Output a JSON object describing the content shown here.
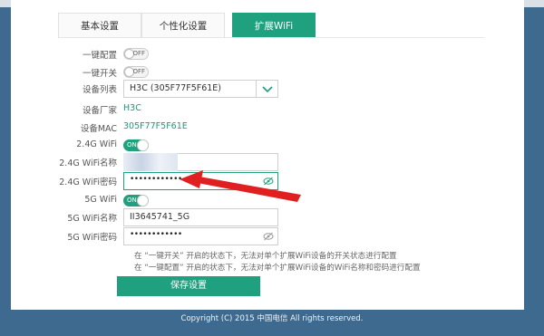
{
  "tabs": [
    {
      "label": "基本设置"
    },
    {
      "label": "个性化设置"
    },
    {
      "label": "扩展WiFi"
    }
  ],
  "form": {
    "one_key_config": {
      "label": "一键配置",
      "state": "OFF"
    },
    "one_key_switch": {
      "label": "一键开关",
      "state": "OFF"
    },
    "device_list": {
      "label": "设备列表",
      "value": "H3C (305F77F5F61E)"
    },
    "vendor": {
      "label": "设备厂家",
      "value": "H3C"
    },
    "mac": {
      "label": "设备MAC",
      "value": "305F77F5F61E"
    },
    "wifi24": {
      "label": "2.4G WiFi",
      "state": "ON"
    },
    "wifi24_name": {
      "label": "2.4G WiFi名称",
      "value": ""
    },
    "wifi24_pwd": {
      "label": "2.4G WiFi密码",
      "value": "••••••••••••"
    },
    "wifi5": {
      "label": "5G WiFi",
      "state": "ON"
    },
    "wifi5_name": {
      "label": "5G WiFi名称",
      "value": "II3645741_5G"
    },
    "wifi5_pwd": {
      "label": "5G WiFi密码",
      "value": "••••••••••••"
    }
  },
  "notes": [
    "在 “一键开关” 开启的状态下，无法对单个扩展WiFi设备的开关状态进行配置",
    "在 “一键配置” 开启的状态下，无法对单个扩展WiFi设备的WiFi名称和密码进行配置"
  ],
  "save_label": "保存设置",
  "footer": "Copyright (C) 2015 中国电信 All rights reserved.",
  "colors": {
    "accent": "#1fa07e",
    "annotation_arrow": "#e02020",
    "background": "#3f6a8f"
  }
}
